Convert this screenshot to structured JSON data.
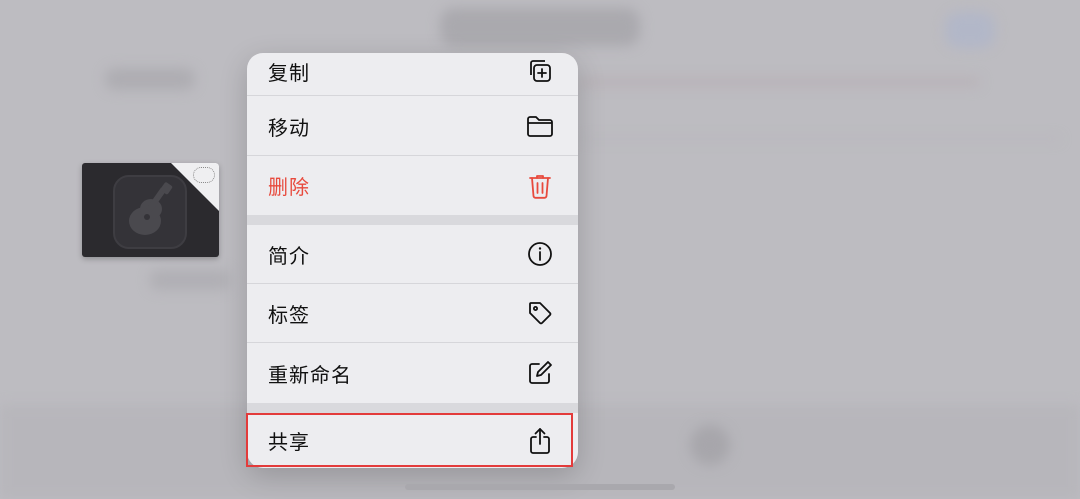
{
  "menu": {
    "items": [
      {
        "label": "复制",
        "icon": "duplicate-icon"
      },
      {
        "label": "移动",
        "icon": "folder-icon"
      },
      {
        "label": "删除",
        "icon": "trash-icon",
        "color": "#e84a3d"
      },
      {
        "label": "简介",
        "icon": "info-icon"
      },
      {
        "label": "标签",
        "icon": "tag-icon"
      },
      {
        "label": "重新命名",
        "icon": "rename-icon"
      },
      {
        "label": "共享",
        "icon": "share-icon"
      }
    ],
    "highlight_color": "#e33b3b"
  },
  "file": {
    "icon": "garageband-icon"
  }
}
